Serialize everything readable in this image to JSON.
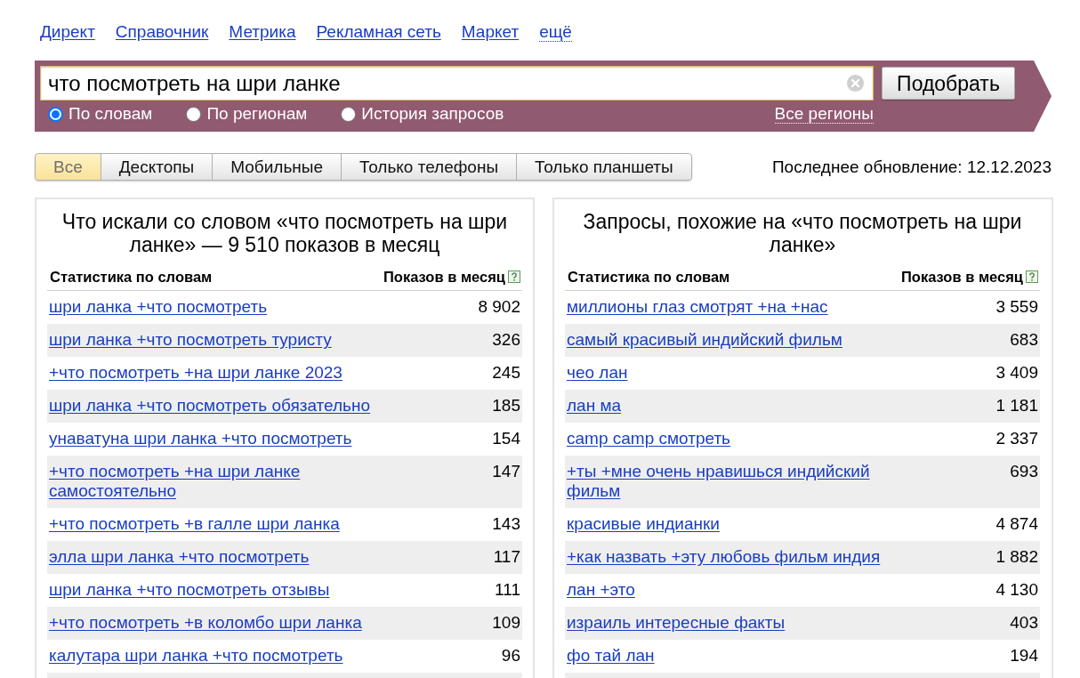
{
  "top_links": [
    {
      "label": "Директ",
      "kind": "link"
    },
    {
      "label": "Справочник",
      "kind": "link"
    },
    {
      "label": "Метрика",
      "kind": "link"
    },
    {
      "label": "Рекламная сеть",
      "kind": "link"
    },
    {
      "label": "Маркет",
      "kind": "link"
    },
    {
      "label": "ещё",
      "kind": "dropdown"
    }
  ],
  "search": {
    "value": "что посмотреть на шри ланке",
    "button": "Подобрать",
    "modes": [
      {
        "label": "По словам",
        "selected": true
      },
      {
        "label": "По регионам",
        "selected": false
      },
      {
        "label": "История запросов",
        "selected": false
      }
    ],
    "region_link": "Все регионы"
  },
  "device_tabs": [
    {
      "label": "Все",
      "selected": true
    },
    {
      "label": "Десктопы",
      "selected": false
    },
    {
      "label": "Мобильные",
      "selected": false
    },
    {
      "label": "Только телефоны",
      "selected": false
    },
    {
      "label": "Только планшеты",
      "selected": false
    }
  ],
  "last_update": "Последнее обновление: 12.12.2023",
  "panels": [
    {
      "title": "Что искали со словом «что посмотреть на шри ланке» — 9 510 показов в месяц",
      "columns": [
        "Статистика по словам",
        "Показов в месяц"
      ],
      "rows": [
        {
          "phrase": "шри ланка +что посмотреть",
          "count": "8 902"
        },
        {
          "phrase": "шри ланка +что посмотреть туристу",
          "count": "326"
        },
        {
          "phrase": "+что посмотреть +на шри ланке 2023",
          "count": "245"
        },
        {
          "phrase": "шри ланка +что посмотреть обязательно",
          "count": "185"
        },
        {
          "phrase": "унаватуна шри ланка +что посмотреть",
          "count": "154"
        },
        {
          "phrase": "+что посмотреть +на шри ланке самостоятельно",
          "count": "147"
        },
        {
          "phrase": "+что посмотреть +в галле шри ланка",
          "count": "143"
        },
        {
          "phrase": "элла шри ланка +что посмотреть",
          "count": "117"
        },
        {
          "phrase": "шри ланка +что посмотреть отзывы",
          "count": "111"
        },
        {
          "phrase": "+что посмотреть +в коломбо шри ланка",
          "count": "109"
        },
        {
          "phrase": "калутара шри ланка +что посмотреть",
          "count": "96"
        }
      ]
    },
    {
      "title": "Запросы, похожие на «что посмотреть на шри ланке»",
      "columns": [
        "Статистика по словам",
        "Показов в месяц"
      ],
      "rows": [
        {
          "phrase": "миллионы глаз смотрят +на +нас",
          "count": "3 559"
        },
        {
          "phrase": "самый красивый индийский фильм",
          "count": "683"
        },
        {
          "phrase": "чео лан",
          "count": "3 409"
        },
        {
          "phrase": "лан ма",
          "count": "1 181"
        },
        {
          "phrase": "camp camp смотреть",
          "count": "2 337"
        },
        {
          "phrase": "+ты +мне очень нравишься индийский фильм",
          "count": "693"
        },
        {
          "phrase": "красивые индианки",
          "count": "4 874"
        },
        {
          "phrase": "+как назвать +эту любовь фильм индия",
          "count": "1 882"
        },
        {
          "phrase": "лан +это",
          "count": "4 130"
        },
        {
          "phrase": "израиль интересные факты",
          "count": "403"
        },
        {
          "phrase": "фо тай лан",
          "count": "194"
        }
      ]
    }
  ]
}
